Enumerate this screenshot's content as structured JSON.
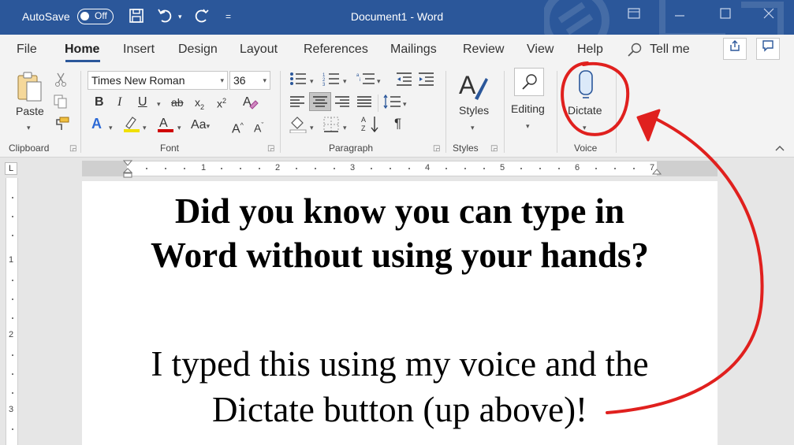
{
  "titlebar": {
    "autosave_label": "AutoSave",
    "autosave_state": "Off",
    "document_title": "Document1",
    "separator": "-",
    "app_name": "Word",
    "bg_color": "#2b579a"
  },
  "tabs": [
    "File",
    "Home",
    "Insert",
    "Design",
    "Layout",
    "References",
    "Mailings",
    "Review",
    "View",
    "Help"
  ],
  "active_tab": "Home",
  "tell_me": "Tell me",
  "clipboard": {
    "paste_label": "Paste",
    "group_label": "Clipboard"
  },
  "font": {
    "font_name": "Times New Roman",
    "font_size": "36",
    "group_label": "Font",
    "change_case": "Aa",
    "clear_format": "A"
  },
  "paragraph": {
    "group_label": "Paragraph"
  },
  "styles": {
    "styles_label": "Styles",
    "group_label": "Styles"
  },
  "editing": {
    "editing_label": "Editing"
  },
  "voice": {
    "dictate_label": "Dictate",
    "group_label": "Voice"
  },
  "ruler": {
    "h_numbers": [
      "1",
      "2",
      "3",
      "4",
      "5",
      "6",
      "7"
    ],
    "v_numbers": [
      "1",
      "2",
      "3"
    ],
    "tab_marker": "L"
  },
  "document": {
    "heading_line1": "Did you know you can type in",
    "heading_line2": "Word without using your hands?",
    "body_line1": "I typed this using my voice and the",
    "body_line2": "Dictate button (up above)!"
  },
  "colors": {
    "annotation_red": "#e0201e",
    "accent_blue": "#2b579a",
    "highlight_yellow": "#f0e000",
    "font_color_red": "#d00000"
  }
}
